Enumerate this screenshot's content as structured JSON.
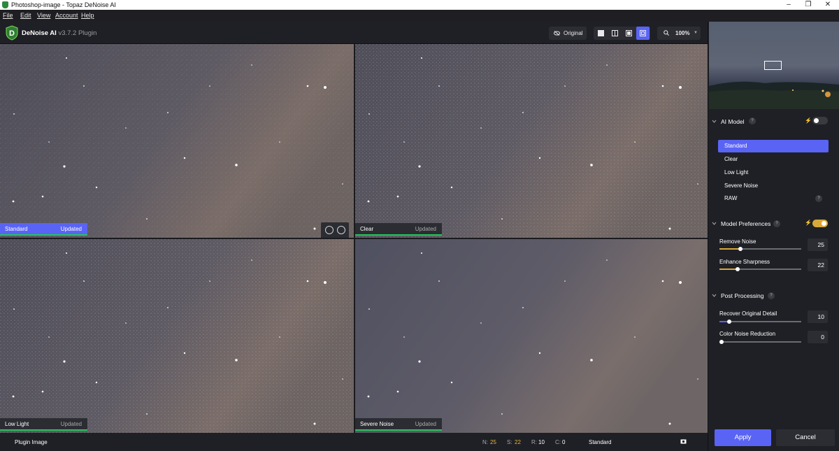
{
  "window": {
    "title": "Photoshop-image - Topaz DeNoise AI",
    "minimize": "–",
    "maximize": "❐",
    "close": "✕"
  },
  "menu": {
    "file": "File",
    "edit": "Edit",
    "view": "View",
    "account": "Account",
    "help": "Help"
  },
  "app": {
    "name": "DeNoise AI",
    "version": "v3.7.2 Plugin"
  },
  "toolbar": {
    "original_label": "Original",
    "zoom": "100%",
    "view_mode_selected": "quad"
  },
  "panels": [
    {
      "name": "Standard",
      "status": "Updated",
      "selected": true
    },
    {
      "name": "Clear",
      "status": "Updated",
      "selected": false
    },
    {
      "name": "Low Light",
      "status": "Updated",
      "selected": false
    },
    {
      "name": "Severe Noise",
      "status": "Updated",
      "selected": false
    }
  ],
  "status": {
    "source": "Plugin Image",
    "n_label": "N:",
    "n_value": "25",
    "s_label": "S:",
    "s_value": "22",
    "r_label": "R:",
    "r_value": "10",
    "c_label": "C:",
    "c_value": "0",
    "model": "Standard"
  },
  "sidebar": {
    "ai_model": {
      "title": "AI Model",
      "help": "?",
      "auto_toggle": false
    },
    "models": [
      {
        "label": "Standard",
        "selected": true
      },
      {
        "label": "Clear",
        "selected": false
      },
      {
        "label": "Low Light",
        "selected": false
      },
      {
        "label": "Severe Noise",
        "selected": false
      },
      {
        "label": "RAW",
        "selected": false
      }
    ],
    "raw_help": "?",
    "model_prefs": {
      "title": "Model Preferences",
      "help": "?",
      "auto_toggle": true,
      "remove_noise": {
        "label": "Remove Noise",
        "value": "25"
      },
      "enhance_sharpness": {
        "label": "Enhance Sharpness",
        "value": "22"
      }
    },
    "post": {
      "title": "Post Processing",
      "help": "?",
      "recover_detail": {
        "label": "Recover Original Detail",
        "value": "10"
      },
      "color_noise": {
        "label": "Color Noise Reduction",
        "value": "0"
      }
    },
    "apply_label": "Apply",
    "cancel_label": "Cancel"
  },
  "colors": {
    "accent": "#5a64f4",
    "updated_bar": "#24c55a",
    "toggle_on": "#d8a93a",
    "sharpness_fill": "#d8a93a",
    "status_value": "#e8b83a"
  }
}
